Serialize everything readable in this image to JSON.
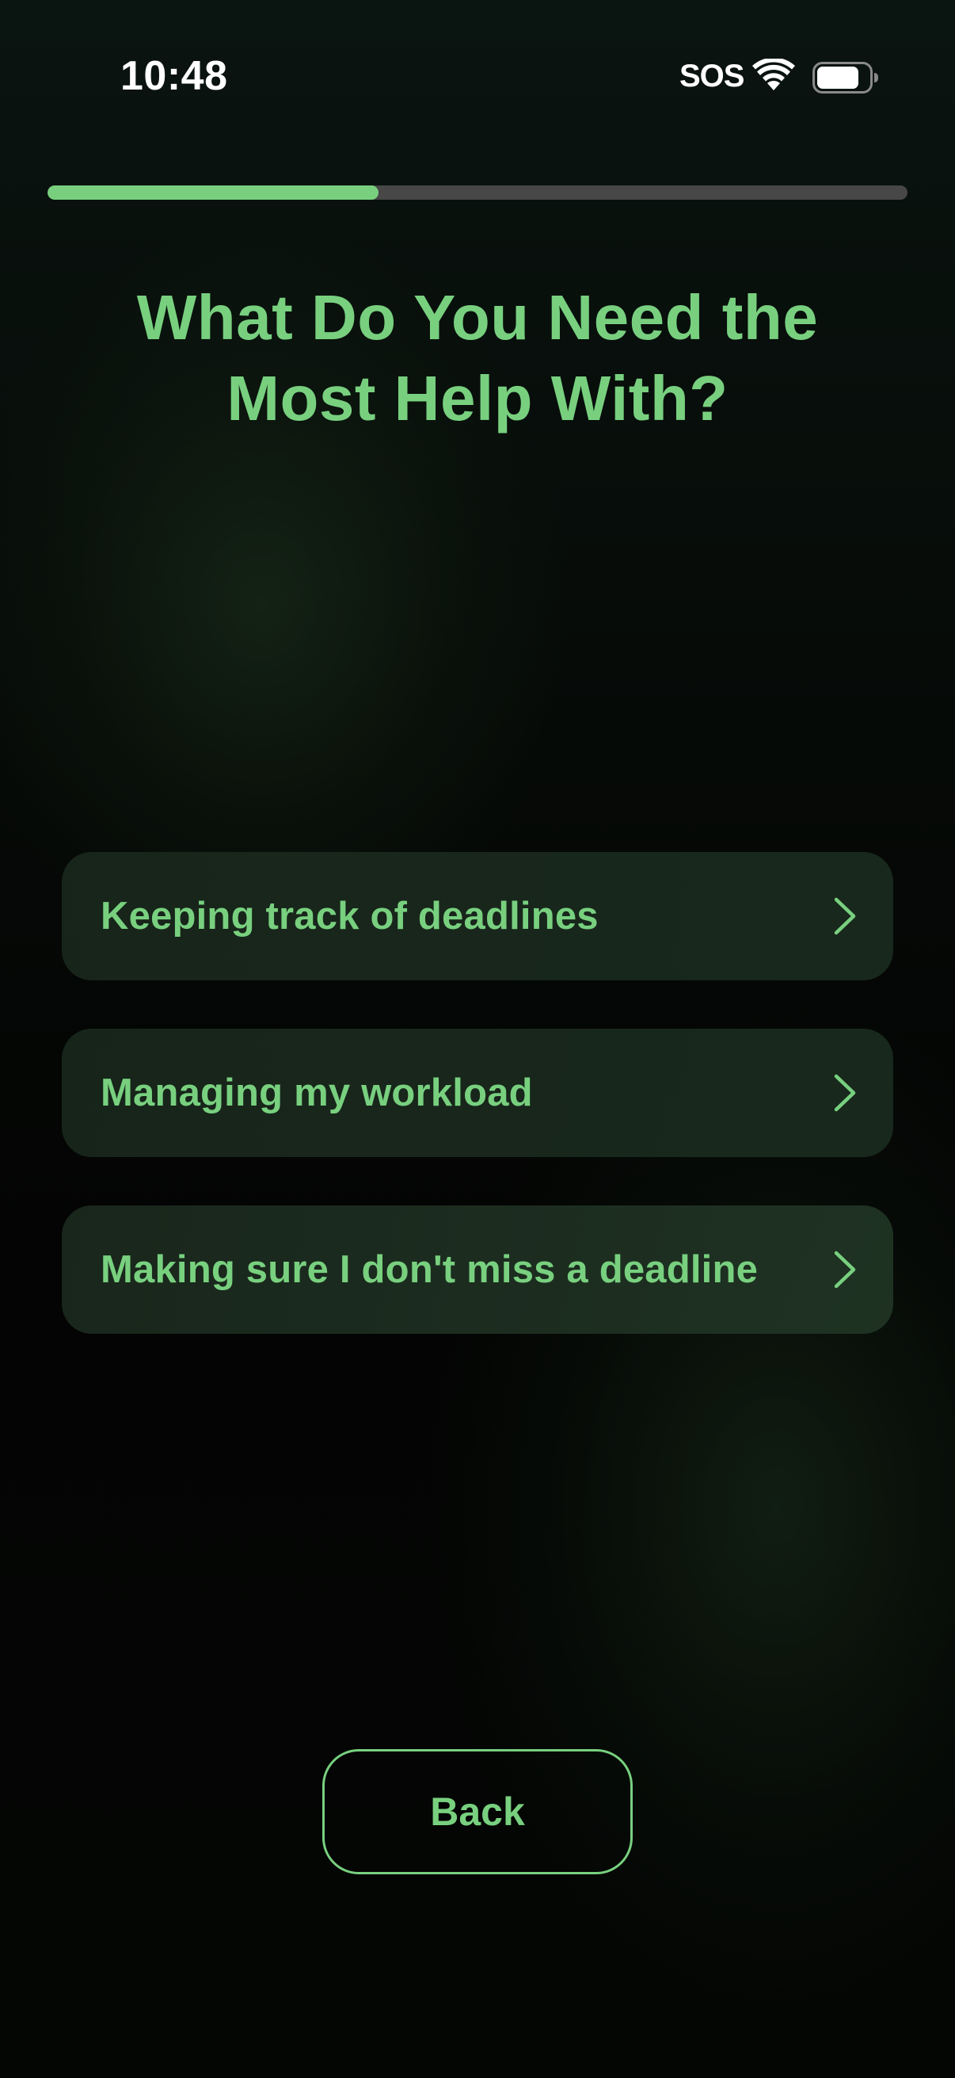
{
  "status_bar": {
    "time": "10:48",
    "sos": "SOS",
    "wifi_icon": "wifi-icon",
    "battery_icon": "battery-icon"
  },
  "progress": {
    "fraction": 0.385
  },
  "title": "What Do You Need the Most Help With?",
  "options": [
    {
      "label": "Keeping track of deadlines",
      "icon": "chevron-right-icon"
    },
    {
      "label": "Managing my workload",
      "icon": "chevron-right-icon"
    },
    {
      "label": "Making sure I don't miss a deadline",
      "icon": "chevron-right-icon"
    }
  ],
  "back_button": {
    "label": "Back"
  },
  "colors": {
    "accent": "#78d07f",
    "track": "#474747",
    "background": "#030403"
  }
}
